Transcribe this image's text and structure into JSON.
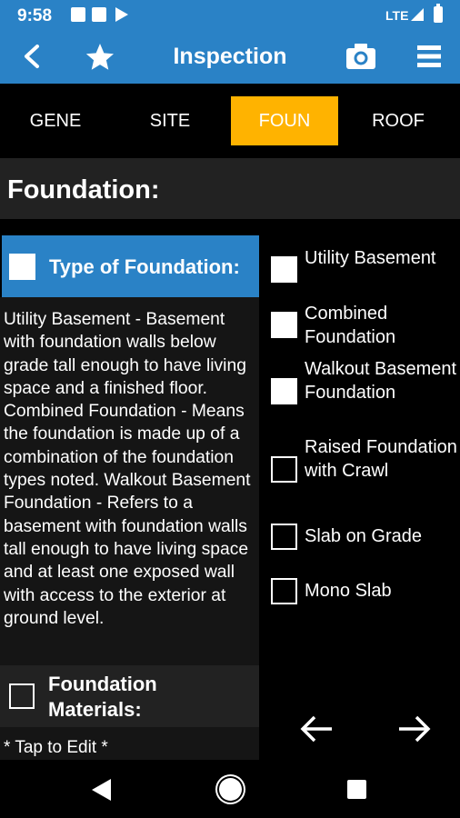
{
  "status_bar": {
    "time": "9:58",
    "notification_icons": [
      "outlook-icon",
      "outlook-icon",
      "play-store-icon"
    ],
    "network": "LTE",
    "icons": [
      "signal-icon",
      "battery-icon"
    ]
  },
  "app_bar": {
    "title": "Inspection",
    "icons": [
      "back-icon",
      "star-icon",
      "camera-icon",
      "menu-icon"
    ],
    "color": "#2a82c6"
  },
  "tabs": [
    {
      "label": "GENE",
      "active": false
    },
    {
      "label": "SITE",
      "active": false
    },
    {
      "label": "FOUN",
      "active": true
    },
    {
      "label": "ROOF",
      "active": false
    }
  ],
  "tab_active_color": "#ffb300",
  "section_title": "Foundation:",
  "type_of_foundation": {
    "label": "Type of Foundation:",
    "checked": true,
    "description": "Utility Basement - Basement with foundation walls below grade tall enough to have living space and a finished floor. Combined Foundation - Means the foundation is made up of a combination of the foundation types noted. Walkout Basement Foundation - Refers to a basement with foundation walls tall enough to have living space and at least one exposed wall with access to the exterior at ground level."
  },
  "options": [
    {
      "label": "Utility Basement",
      "checked": true
    },
    {
      "label": "Combined Foundation",
      "checked": true
    },
    {
      "label": "Walkout Basement Foundation",
      "checked": true
    },
    {
      "label": "Raised Foundation with Crawl",
      "checked": false
    },
    {
      "label": "Slab on Grade",
      "checked": false
    },
    {
      "label": "Mono Slab",
      "checked": false
    }
  ],
  "foundation_materials": {
    "label": "Foundation Materials:",
    "checked": false,
    "value": "* Tap to Edit *"
  },
  "navigation": [
    "arrow-left-icon",
    "arrow-right-icon"
  ],
  "system_nav": [
    "nav-back-icon",
    "nav-home-icon",
    "nav-recents-icon"
  ]
}
